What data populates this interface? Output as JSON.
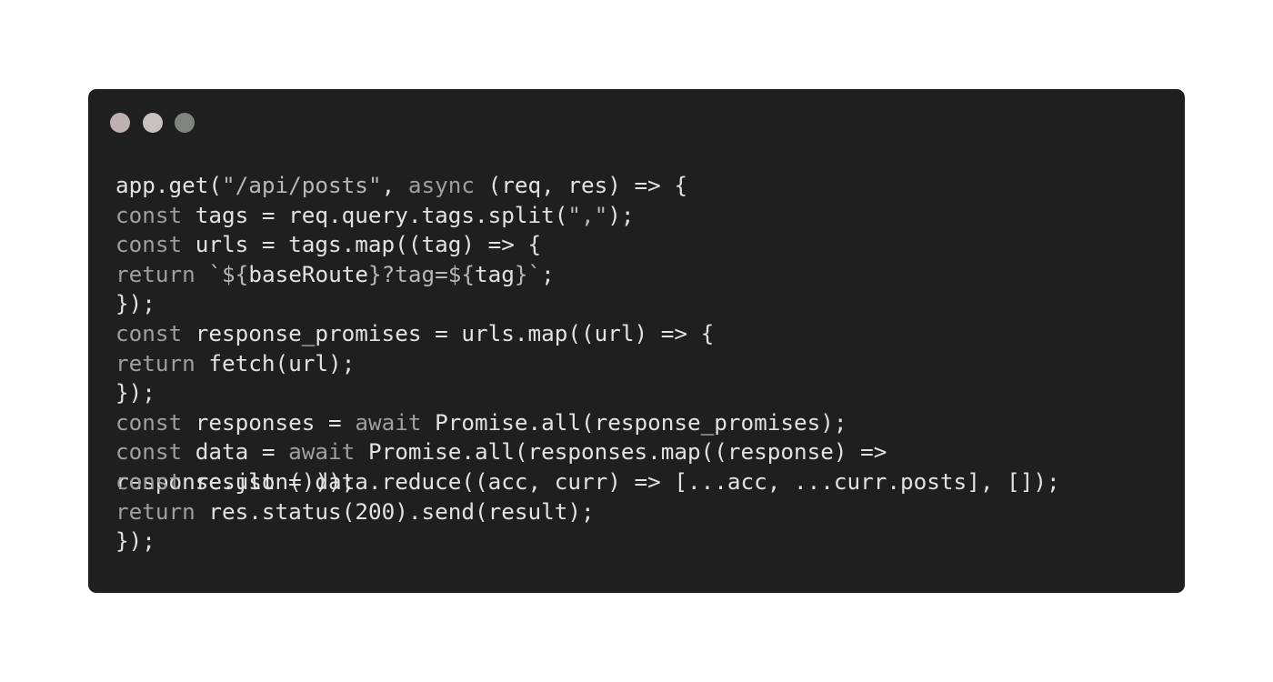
{
  "colors": {
    "window_background": "#1f1f1f",
    "dot_red": "#bfb0b3",
    "dot_yellow": "#c8c0c1",
    "dot_green": "#7e857f",
    "code_text": "#e2e2e2",
    "keyword_text": "#9f9f9f"
  },
  "window_controls": [
    "close-dot",
    "minimize-dot",
    "maximize-dot"
  ],
  "code": {
    "language": "javascript",
    "lines": [
      [
        {
          "t": "app.get(",
          "c": ""
        },
        {
          "t": "\"/api/posts\"",
          "c": "st"
        },
        {
          "t": ", ",
          "c": ""
        },
        {
          "t": "async",
          "c": "kw"
        },
        {
          "t": " (req, res) => {",
          "c": ""
        }
      ],
      [
        {
          "t": "const",
          "c": "kw"
        },
        {
          "t": " tags = req.query.tags.split(",
          "c": ""
        },
        {
          "t": "\",\"",
          "c": "st"
        },
        {
          "t": ");",
          "c": ""
        }
      ],
      [
        {
          "t": "const",
          "c": "kw"
        },
        {
          "t": " urls = tags.map((tag) => {",
          "c": ""
        }
      ],
      [
        {
          "t": "return",
          "c": "kw"
        },
        {
          "t": " ",
          "c": ""
        },
        {
          "t": "`${",
          "c": "st"
        },
        {
          "t": "baseRoute",
          "c": ""
        },
        {
          "t": "}?tag=${",
          "c": "st"
        },
        {
          "t": "tag",
          "c": ""
        },
        {
          "t": "}`",
          "c": "st"
        },
        {
          "t": ";",
          "c": ""
        }
      ],
      [
        {
          "t": "});",
          "c": ""
        }
      ],
      [
        {
          "t": "const",
          "c": "kw"
        },
        {
          "t": " response_promises = urls.map((url) => {",
          "c": ""
        }
      ],
      [
        {
          "t": "return",
          "c": "kw"
        },
        {
          "t": " fetch(url);",
          "c": ""
        }
      ],
      [
        {
          "t": "});",
          "c": ""
        }
      ],
      [
        {
          "t": "const",
          "c": "kw"
        },
        {
          "t": " responses = ",
          "c": ""
        },
        {
          "t": "await",
          "c": "kw"
        },
        {
          "t": " Promise.all(response_promises);",
          "c": ""
        }
      ],
      [
        {
          "t": "const",
          "c": "kw"
        },
        {
          "t": " data = ",
          "c": ""
        },
        {
          "t": "await",
          "c": "kw"
        },
        {
          "t": " Promise.all(responses.map((response) =>",
          "c": ""
        }
      ],
      [
        {
          "t": "response.json()));",
          "c": ""
        }
      ],
      [
        {
          "t": "const",
          "c": "kw"
        },
        {
          "t": " result = data.reduce((acc, curr) => [...acc, ...curr.posts], []);",
          "c": ""
        }
      ],
      [
        {
          "t": "return",
          "c": "kw"
        },
        {
          "t": " res.status(200).send(result);",
          "c": ""
        }
      ],
      [
        {
          "t": "});",
          "c": ""
        }
      ]
    ]
  }
}
